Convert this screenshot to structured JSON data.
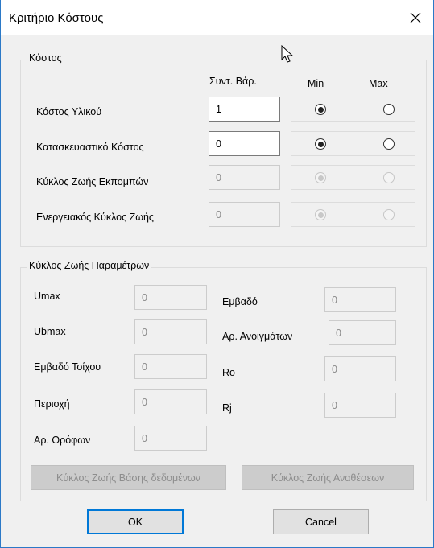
{
  "window": {
    "title": "Κριτήριο Κόστους",
    "close_glyph": "✕"
  },
  "cost_group": {
    "title": "Κόστος",
    "headers": {
      "weight": "Συντ. Βάρ.",
      "min": "Min",
      "max": "Max"
    },
    "rows": [
      {
        "label": "Κόστος Υλικού",
        "value": "1",
        "enabled": true,
        "selected": "min"
      },
      {
        "label": "Κατασκευαστικό Κόστος",
        "value": "0",
        "enabled": true,
        "selected": "min"
      },
      {
        "label": "Κύκλος Ζωής Εκπομπών",
        "value": "0",
        "enabled": false,
        "selected": "min"
      },
      {
        "label": "Ενεργειακός Κύκλος Ζωής",
        "value": "0",
        "enabled": false,
        "selected": "min"
      }
    ]
  },
  "lifecycle_group": {
    "title": "Κύκλος Ζωής Παραμέτρων",
    "left_fields": [
      {
        "label": "Umax",
        "value": "0"
      },
      {
        "label": "Ubmax",
        "value": "0"
      },
      {
        "label": "Εμβαδό Τοίχου",
        "value": "0"
      },
      {
        "label": "Περιοχή",
        "value": "0"
      },
      {
        "label": "Αρ. Ορόφων",
        "value": "0"
      }
    ],
    "right_fields": [
      {
        "label": "Εμβαδό",
        "value": "0"
      },
      {
        "label": "Αρ. Ανοιγμάτων",
        "value": "0"
      },
      {
        "label": "Ro",
        "value": "0"
      },
      {
        "label": "Rj",
        "value": "0"
      }
    ],
    "db_button": "Κύκλος Ζωής Βάσης δεδομένων",
    "assign_button": "Κύκλος Ζωής Αναθέσεων"
  },
  "ok_label": "OK",
  "cancel_label": "Cancel",
  "colors": {
    "accent": "#0078d7",
    "frame": "#2b79c7"
  }
}
